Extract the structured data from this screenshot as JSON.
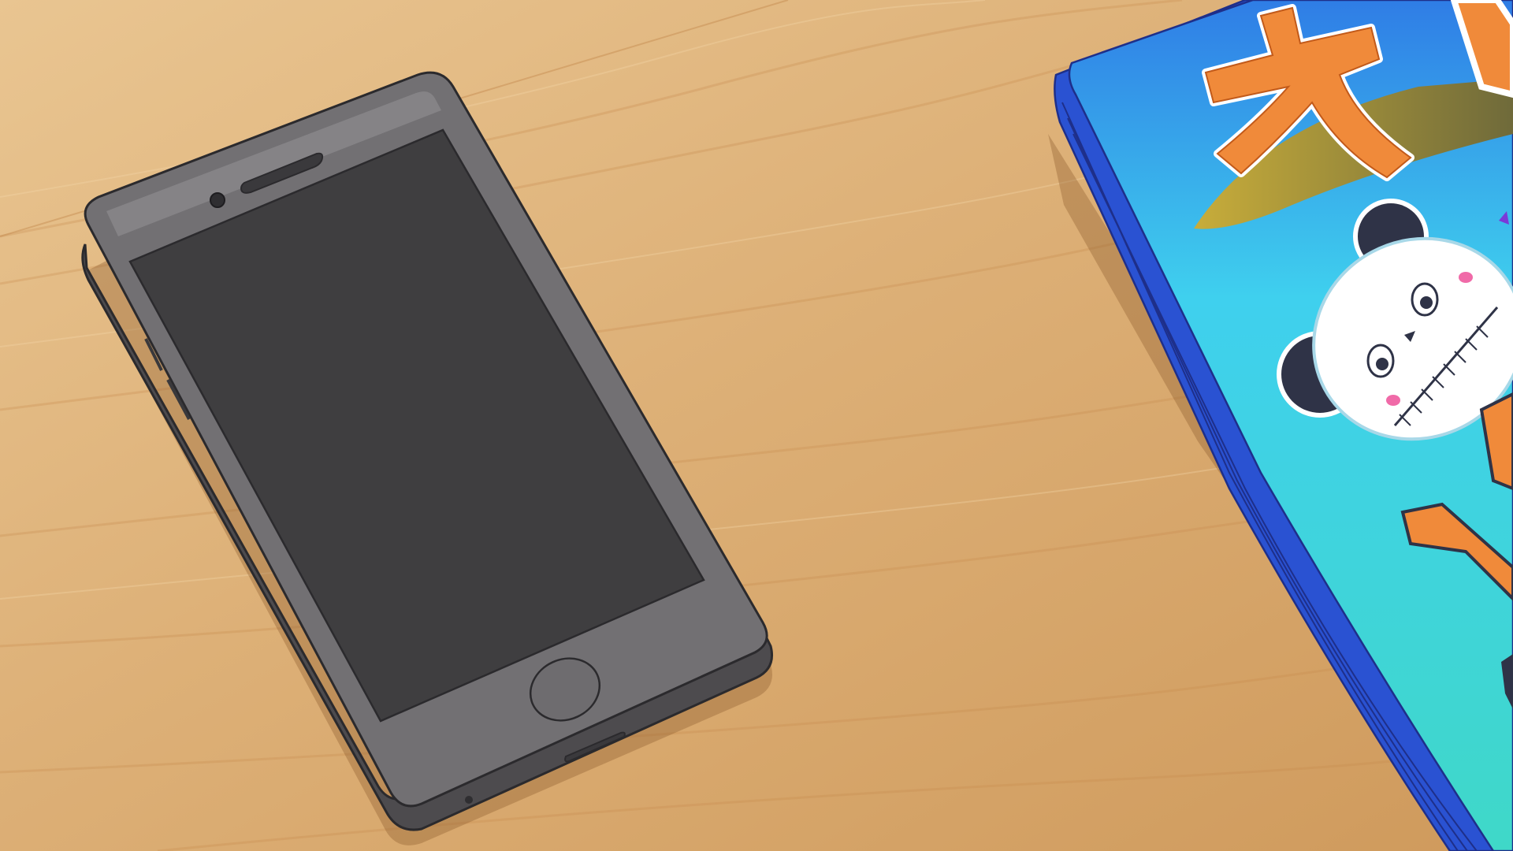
{
  "scene": {
    "description_visible_text": "",
    "colors": {
      "wood_light": "#e8c48f",
      "wood_mid": "#d9aa6e",
      "wood_dark": "#c98f52",
      "wood_grain": "#c4894c",
      "phone_body": "#6e6c6f",
      "phone_body_light": "#8a888b",
      "phone_edge": "#4a484b",
      "phone_screen": "#3f3e40",
      "phone_outline": "#2b2a2d",
      "magazine_cyan": "#3fd2ea",
      "magazine_blue": "#2f6fe0",
      "magazine_edge_blue": "#2a4fd0",
      "magazine_orange": "#f08a3a",
      "magazine_olive": "#9a8a3a",
      "panda_white": "#ffffff",
      "panda_dark": "#2f3347",
      "panda_pink": "#f06aa8"
    },
    "objects": {
      "phone": "smartphone-lying-on-table",
      "magazine": "stack-of-magazines",
      "table": "wooden-table-surface"
    }
  }
}
